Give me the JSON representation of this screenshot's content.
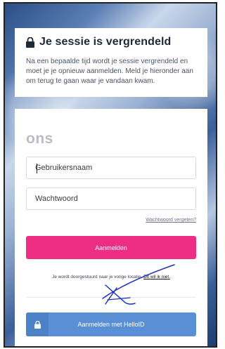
{
  "lock_notice": {
    "title": "Je sessie is vergrendeld",
    "description": "Na een bepaalde tijd wordt je sessie vergrendeld en moet je je opnieuw aanmelden. Meld je hieronder aan om terug te gaan waar je vandaan kwam."
  },
  "login": {
    "logo_text": "ons",
    "username_placeholder": "Gebruikersnaam",
    "password_placeholder": "Wachtwoord",
    "forgot_password": "Wachtwoord vergeten?",
    "submit_label": "Aanmelden",
    "redirect_text": "Je wordt doorgestuurd naar je vorige locatie.",
    "redirect_link": "Dit wil ik niet.",
    "helloid_label": "Aanmelden met HelloID"
  },
  "colors": {
    "primary_button": "#ee2d84",
    "helloid_button": "#5a8fd6",
    "annotation_ink": "#1d2fc0"
  }
}
